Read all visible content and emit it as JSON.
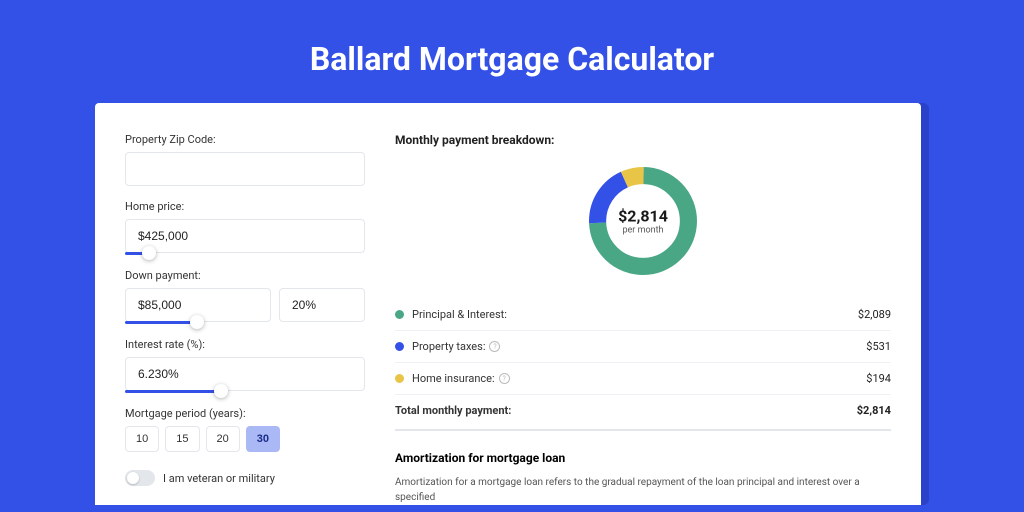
{
  "hero": {
    "title": "Ballard Mortgage Calculator"
  },
  "form": {
    "zip": {
      "label": "Property Zip Code:",
      "value": ""
    },
    "home_price": {
      "label": "Home price:",
      "value": "$425,000"
    },
    "down_payment": {
      "label": "Down payment:",
      "amount": "$85,000",
      "percent": "20%"
    },
    "interest_rate": {
      "label": "Interest rate (%):",
      "value": "6.230%"
    },
    "period": {
      "label": "Mortgage period (years):",
      "options": [
        "10",
        "15",
        "20",
        "30"
      ],
      "selected": "30"
    },
    "veteran": {
      "label": "I am veteran or military"
    }
  },
  "breakdown": {
    "title": "Monthly payment breakdown:",
    "center_amount": "$2,814",
    "center_sub": "per month",
    "rows": [
      {
        "label": "Principal & Interest:",
        "amount": "$2,089"
      },
      {
        "label": "Property taxes:",
        "amount": "$531"
      },
      {
        "label": "Home insurance:",
        "amount": "$194"
      }
    ],
    "total": {
      "label": "Total monthly payment:",
      "amount": "$2,814"
    }
  },
  "amort": {
    "title": "Amortization for mortgage loan",
    "text": "Amortization for a mortgage loan refers to the gradual repayment of the loan principal and interest over a specified"
  },
  "chart_data": {
    "type": "pie",
    "title": "Monthly payment breakdown",
    "series": [
      {
        "name": "Principal & Interest",
        "value": 2089,
        "color": "#4aa786"
      },
      {
        "name": "Property taxes",
        "value": 531,
        "color": "#3351e7"
      },
      {
        "name": "Home insurance",
        "value": 194,
        "color": "#e8c547"
      }
    ],
    "total": 2814
  }
}
